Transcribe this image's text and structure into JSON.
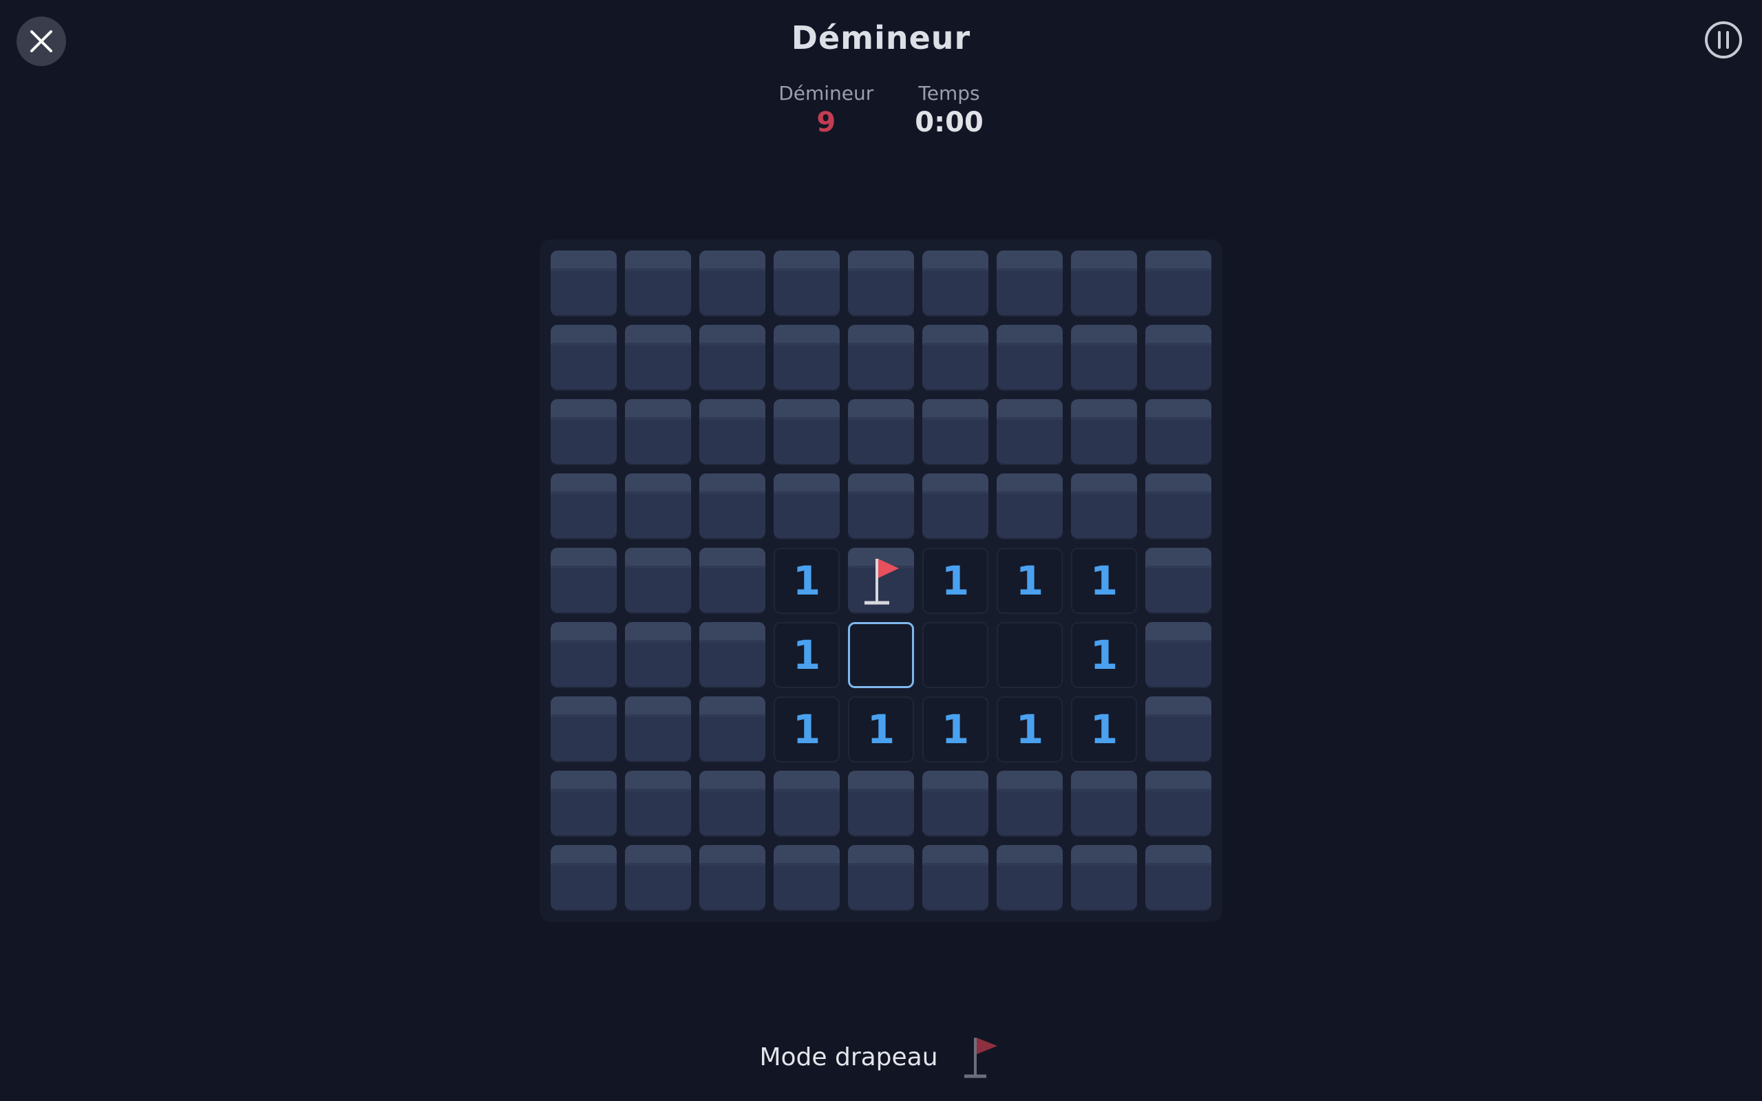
{
  "header": {
    "title": "Démineur",
    "close_icon": "close-icon",
    "pause_icon": "pause-icon"
  },
  "stats": {
    "mines_label": "Démineur",
    "mines_value": "9",
    "time_label": "Temps",
    "time_value": "0:00"
  },
  "board": {
    "rows": 9,
    "cols": 9,
    "cells": [
      [
        "c",
        "c",
        "c",
        "c",
        "c",
        "c",
        "c",
        "c",
        "c"
      ],
      [
        "c",
        "c",
        "c",
        "c",
        "c",
        "c",
        "c",
        "c",
        "c"
      ],
      [
        "c",
        "c",
        "c",
        "c",
        "c",
        "c",
        "c",
        "c",
        "c"
      ],
      [
        "c",
        "c",
        "c",
        "c",
        "c",
        "c",
        "c",
        "c",
        "c"
      ],
      [
        "c",
        "c",
        "c",
        "1",
        "F",
        "1",
        "1",
        "1",
        "c"
      ],
      [
        "c",
        "c",
        "c",
        "1",
        "S",
        "0",
        "0",
        "1",
        "c"
      ],
      [
        "c",
        "c",
        "c",
        "1",
        "1",
        "1",
        "1",
        "1",
        "c"
      ],
      [
        "c",
        "c",
        "c",
        "c",
        "c",
        "c",
        "c",
        "c",
        "c"
      ],
      [
        "c",
        "c",
        "c",
        "c",
        "c",
        "c",
        "c",
        "c",
        "c"
      ]
    ],
    "legend": {
      "c": "covered",
      "F": "flagged",
      "S": "selected-empty",
      "0": "revealed-empty"
    },
    "number_color": "#4aa1f0",
    "flag_color": "#e8505b"
  },
  "footer": {
    "flag_mode_label": "Mode drapeau",
    "flag_mode_icon": "flag-icon",
    "flag_mode_color": "#8e3040"
  }
}
